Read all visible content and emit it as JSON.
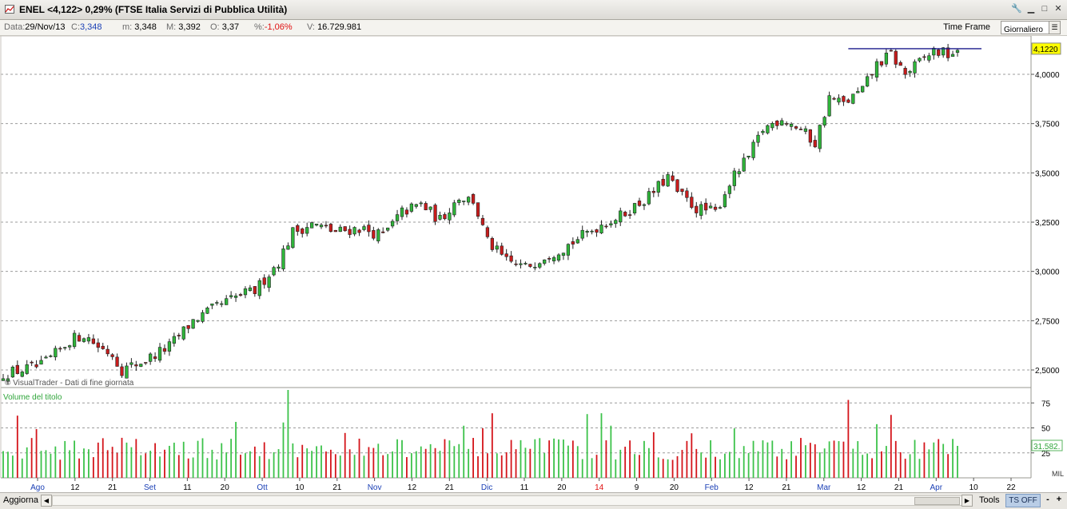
{
  "window": {
    "title": "ENEL <4,122> 0,29%  (FTSE Italia Servizi di Pubblica Utilità)"
  },
  "infobar": {
    "data_label": "Data:",
    "data_value": "29/Nov/13",
    "c_label": "C:",
    "c_value": "3,348",
    "m_label": "m:",
    "m_value": "3,348",
    "M_label": "M:",
    "M_value": "3,392",
    "o_label": "O:",
    "o_value": "3,37",
    "pct_label": "%:",
    "pct_value": "-1,06%",
    "v_label": "V:",
    "v_value": "16.729.981",
    "timeframe_label": "Time Frame",
    "timeframe_value": "Giornaliero"
  },
  "statusbar": {
    "aggiorna": "Aggiorna",
    "tools": "Tools",
    "ts_off": "TS OFF",
    "zoom_out": "-",
    "zoom_in": "+"
  },
  "colors": {
    "up": "#2fb53a",
    "down": "#c81c1c",
    "volume_up": "#3cc24a",
    "volume_down": "#d4141a",
    "month_label": "#1a3fb5",
    "year_label": "#e01010",
    "last_price_bg": "#ffff00",
    "resistance_line": "#1a1a8c"
  },
  "chart_data": [
    {
      "type": "candlestick",
      "credit": "© VisualTrader - Dati di fine giornata",
      "y_ticks": [
        "2,5000",
        "2,7500",
        "3,0000",
        "3,2500",
        "3,5000",
        "3,7500",
        "4,0000"
      ],
      "ylim": [
        2.48,
        4.14
      ],
      "last_price_label": "4,1220",
      "resistance_level": 4.13,
      "grid": "horizontal dashed",
      "x_labels": [
        {
          "text": "Ago",
          "kind": "month"
        },
        {
          "text": "12",
          "kind": "day"
        },
        {
          "text": "21",
          "kind": "day"
        },
        {
          "text": "Set",
          "kind": "month"
        },
        {
          "text": "11",
          "kind": "day"
        },
        {
          "text": "20",
          "kind": "day"
        },
        {
          "text": "Ott",
          "kind": "month"
        },
        {
          "text": "10",
          "kind": "day"
        },
        {
          "text": "21",
          "kind": "day"
        },
        {
          "text": "Nov",
          "kind": "month"
        },
        {
          "text": "12",
          "kind": "day"
        },
        {
          "text": "21",
          "kind": "day"
        },
        {
          "text": "Dic",
          "kind": "month"
        },
        {
          "text": "11",
          "kind": "day"
        },
        {
          "text": "20",
          "kind": "day"
        },
        {
          "text": "14",
          "kind": "year"
        },
        {
          "text": "9",
          "kind": "day"
        },
        {
          "text": "20",
          "kind": "day"
        },
        {
          "text": "Feb",
          "kind": "month"
        },
        {
          "text": "12",
          "kind": "day"
        },
        {
          "text": "21",
          "kind": "day"
        },
        {
          "text": "Mar",
          "kind": "month"
        },
        {
          "text": "12",
          "kind": "day"
        },
        {
          "text": "21",
          "kind": "day"
        },
        {
          "text": "Apr",
          "kind": "month"
        },
        {
          "text": "10",
          "kind": "day"
        },
        {
          "text": "22",
          "kind": "day"
        }
      ],
      "close_path": [
        [
          0,
          2.48
        ],
        [
          8,
          2.52
        ],
        [
          12,
          2.6
        ],
        [
          14,
          2.65
        ],
        [
          17,
          2.68
        ],
        [
          20,
          2.62
        ],
        [
          23,
          2.58
        ],
        [
          25,
          2.5
        ],
        [
          28,
          2.53
        ],
        [
          30,
          2.55
        ],
        [
          35,
          2.62
        ],
        [
          40,
          2.75
        ],
        [
          45,
          2.82
        ],
        [
          50,
          2.88
        ],
        [
          53,
          2.9
        ],
        [
          58,
          3.05
        ],
        [
          61,
          3.2
        ],
        [
          65,
          3.24
        ],
        [
          70,
          3.2
        ],
        [
          75,
          3.22
        ],
        [
          80,
          3.18
        ],
        [
          84,
          3.3
        ],
        [
          88,
          3.34
        ],
        [
          92,
          3.26
        ],
        [
          96,
          3.38
        ],
        [
          99,
          3.36
        ],
        [
          102,
          3.15
        ],
        [
          106,
          3.05
        ],
        [
          110,
          3.02
        ],
        [
          114,
          3.08
        ],
        [
          118,
          3.12
        ],
        [
          122,
          3.18
        ],
        [
          126,
          3.24
        ],
        [
          130,
          3.28
        ],
        [
          136,
          3.38
        ],
        [
          140,
          3.48
        ],
        [
          142,
          3.4
        ],
        [
          146,
          3.32
        ],
        [
          150,
          3.3
        ],
        [
          153,
          3.45
        ],
        [
          157,
          3.58
        ],
        [
          160,
          3.72
        ],
        [
          164,
          3.78
        ],
        [
          168,
          3.72
        ],
        [
          171,
          3.65
        ],
        [
          174,
          3.88
        ],
        [
          177,
          3.85
        ],
        [
          181,
          3.92
        ],
        [
          184,
          4.05
        ],
        [
          187,
          4.1
        ],
        [
          190,
          4.0
        ],
        [
          193,
          4.06
        ],
        [
          196,
          4.12
        ],
        [
          199,
          4.1
        ],
        [
          201,
          4.122
        ]
      ],
      "candle_count": 202
    },
    {
      "type": "bar",
      "title": "Volume del titolo",
      "y_ticks": [
        "25",
        "50",
        "75"
      ],
      "unit": "MIL",
      "last_volume_label": "31.582.",
      "ylim": [
        0,
        90
      ],
      "value_range_mil": [
        10,
        88
      ]
    }
  ]
}
